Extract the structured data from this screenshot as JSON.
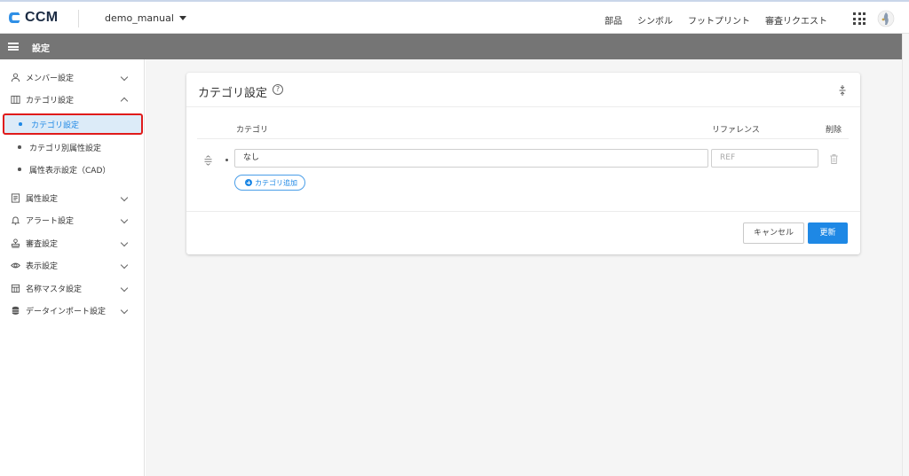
{
  "header": {
    "logo_text": "CCM",
    "project_name": "demo_manual",
    "nav": [
      "部品",
      "シンボル",
      "フットプリント",
      "審査リクエスト"
    ]
  },
  "settings_bar": {
    "title": "設定"
  },
  "sidebar": {
    "items": [
      {
        "label": "メンバー設定",
        "icon": "person-icon",
        "expanded": false
      },
      {
        "label": "カテゴリ設定",
        "icon": "category-icon",
        "expanded": true
      },
      {
        "label": "属性設定",
        "icon": "attribute-icon",
        "expanded": false
      },
      {
        "label": "アラート設定",
        "icon": "bell-icon",
        "expanded": false
      },
      {
        "label": "審査設定",
        "icon": "stamp-icon",
        "expanded": false
      },
      {
        "label": "表示設定",
        "icon": "eye-icon",
        "expanded": false
      },
      {
        "label": "名称マスタ設定",
        "icon": "calculator-icon",
        "expanded": false
      },
      {
        "label": "データインポート設定",
        "icon": "database-icon",
        "expanded": false
      }
    ],
    "sub_items": [
      {
        "label": "カテゴリ設定",
        "active": true
      },
      {
        "label": "カテゴリ別属性設定",
        "active": false
      },
      {
        "label": "属性表示設定（CAD）",
        "active": false
      }
    ]
  },
  "card": {
    "title": "カテゴリ設定",
    "columns": {
      "category": "カテゴリ",
      "reference": "リファレンス",
      "delete": "削除"
    },
    "rows": [
      {
        "category": "なし",
        "reference_placeholder": "REF"
      }
    ],
    "add_button": "カテゴリ追加",
    "cancel_button": "キャンセル",
    "update_button": "更新"
  },
  "colors": {
    "accent": "#1e88e5",
    "settings_bar": "#757575",
    "active_highlight": "#dcebf8",
    "annotation_red": "#e01b1b"
  }
}
